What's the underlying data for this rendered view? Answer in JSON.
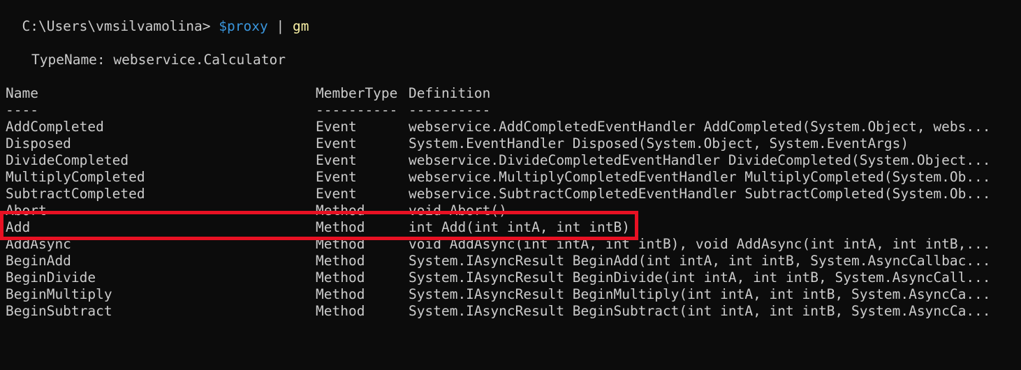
{
  "prompt": {
    "path": "C:\\Users\\vmsilvamolina>",
    "variable": "$proxy",
    "pipe": "|",
    "command": "gm"
  },
  "typename_line": "TypeName: webservice.Calculator",
  "headers": {
    "name": "Name",
    "member_type": "MemberType",
    "definition": "Definition"
  },
  "separators": {
    "name": "----",
    "member_type": "----------",
    "definition": "----------"
  },
  "rows": [
    {
      "name": "AddCompleted",
      "type": "Event",
      "definition": "webservice.AddCompletedEventHandler AddCompleted(System.Object, webs..."
    },
    {
      "name": "Disposed",
      "type": "Event",
      "definition": "System.EventHandler Disposed(System.Object, System.EventArgs)"
    },
    {
      "name": "DivideCompleted",
      "type": "Event",
      "definition": "webservice.DivideCompletedEventHandler DivideCompleted(System.Object..."
    },
    {
      "name": "MultiplyCompleted",
      "type": "Event",
      "definition": "webservice.MultiplyCompletedEventHandler MultiplyCompleted(System.Ob..."
    },
    {
      "name": "SubtractCompleted",
      "type": "Event",
      "definition": "webservice.SubtractCompletedEventHandler SubtractCompleted(System.Ob..."
    },
    {
      "name": "Abort",
      "type": "Method",
      "definition": "void Abort()"
    },
    {
      "name": "Add",
      "type": "Method",
      "definition": "int Add(int intA, int intB)"
    },
    {
      "name": "AddAsync",
      "type": "Method",
      "definition": "void AddAsync(int intA, int intB), void AddAsync(int intA, int intB,..."
    },
    {
      "name": "BeginAdd",
      "type": "Method",
      "definition": "System.IAsyncResult BeginAdd(int intA, int intB, System.AsyncCallbac..."
    },
    {
      "name": "BeginDivide",
      "type": "Method",
      "definition": "System.IAsyncResult BeginDivide(int intA, int intB, System.AsyncCall..."
    },
    {
      "name": "BeginMultiply",
      "type": "Method",
      "definition": "System.IAsyncResult BeginMultiply(int intA, int intB, System.AsyncCa..."
    },
    {
      "name": "BeginSubtract",
      "type": "Method",
      "definition": "System.IAsyncResult BeginSubtract(int intA, int intB, System.AsyncCa..."
    }
  ],
  "colors": {
    "background": "#0c0c0c",
    "foreground": "#cccccc",
    "variable": "#3a96dd",
    "command": "#f9f1a5",
    "highlight_border": "#e81123"
  }
}
